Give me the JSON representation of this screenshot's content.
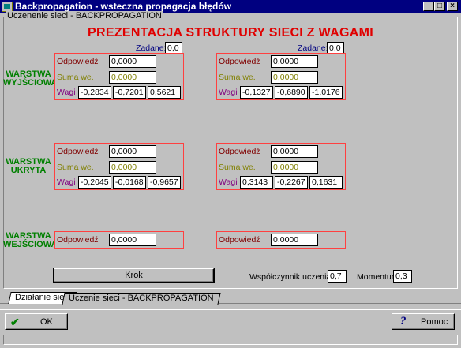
{
  "window": {
    "title": "Backpropagation - wsteczna propagacja błędów",
    "controls": {
      "minimize": "_",
      "maximize": "□",
      "close": "×"
    }
  },
  "group_label": "Uczenenie sieci - BACKPROPAGATION",
  "heading": "PREZENTACJA STRUKTURY SIECI Z WAGAMI",
  "zadane_label": "Zadane:",
  "layers": {
    "output": "WARSTWA WYJŚCIOWA",
    "hidden": "WARSTWA UKRYTA",
    "input": "WARSTWA WEJŚCIOWA"
  },
  "labels": {
    "odpowiedz": "Odpowiedź",
    "suma": "Suma we.",
    "wagi": "Wagi"
  },
  "neurons": {
    "out1": {
      "zadane": "0,0",
      "odpowiedz": "0,0000",
      "suma": "0,0000",
      "wagi": [
        "-0,2834",
        "-0,7201",
        "0,5621"
      ]
    },
    "out2": {
      "zadane": "0,0",
      "odpowiedz": "0,0000",
      "suma": "0,0000",
      "wagi": [
        "-0,1327",
        "-0,6890",
        "-1,0176"
      ]
    },
    "hid1": {
      "odpowiedz": "0,0000",
      "suma": "0,0000",
      "wagi": [
        "-0,2045",
        "-0,0168",
        "-0,9657"
      ]
    },
    "hid2": {
      "odpowiedz": "0,0000",
      "suma": "0,0000",
      "wagi": [
        "0,3143",
        "-0,2267",
        "0,1631"
      ]
    },
    "in1": {
      "odpowiedz": "0,0000"
    },
    "in2": {
      "odpowiedz": "0,0000"
    }
  },
  "controls": {
    "krok_label": "Krok",
    "learning_rate_label": "Współczynnik uczenia:",
    "learning_rate": "0,7",
    "momentum_label": "Momentum:",
    "momentum": "0,3"
  },
  "tabs": [
    "Działanie sieci",
    "Uczenie sieci - BACKPROPAGATION"
  ],
  "footer": {
    "ok_label": "OK",
    "help_label": "Pomoc"
  },
  "colors": {
    "title_bar": "#000080",
    "heading": "#e00000",
    "layer_label": "#008000",
    "box_border": "#ff4040"
  }
}
